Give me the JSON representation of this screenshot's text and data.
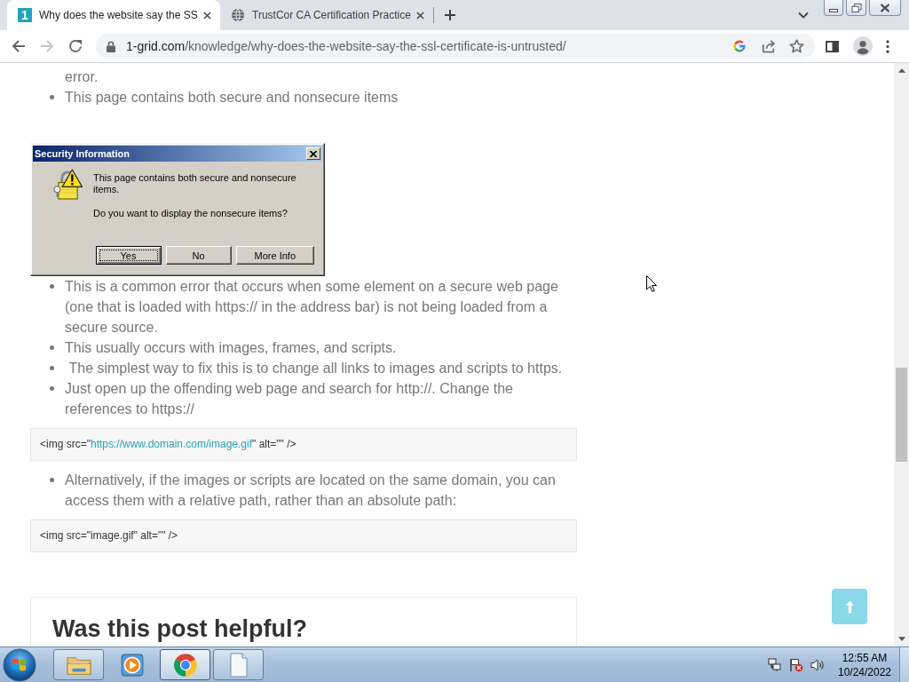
{
  "browser": {
    "tabs": [
      {
        "kind": "logo",
        "favicon_text": "1",
        "title": "Why does the website say the SS",
        "selected": true
      },
      {
        "kind": "globe",
        "title": "TrustCor CA Certification Practice",
        "selected": false
      }
    ],
    "navigation": [
      {
        "kind": "back",
        "disabled": false
      },
      {
        "kind": "forward",
        "disabled": true
      },
      {
        "kind": "reload",
        "disabled": false
      }
    ],
    "address_bar": {
      "host": "1-grid.com",
      "path": "/knowledge/why-does-the-website-say-the-ssl-certificate-is-untrusted/"
    }
  },
  "article": {
    "continued_text": "error.",
    "list_1": [
      "This page contains both secure and nonsecure items"
    ],
    "dialog": {
      "title": "Security Information",
      "message": "This page contains both secure and nonsecure items.",
      "question": "Do you want to display the nonsecure items?",
      "buttons": [
        {
          "label": "Yes",
          "focused": true
        },
        {
          "label": "No",
          "focused": false
        },
        {
          "label": "More Info",
          "focused": false
        }
      ]
    },
    "list_2": [
      "This is a common error that occurs when some element on a secure web page (one that is loaded with https:// in the address bar) is not being loaded from a secure source.",
      "This usually occurs with images, frames, and scripts.",
      " The simplest way to fix this is to change all links to images and scripts to https.",
      "Just open up the offending web page and search for http://. Change the references to https://"
    ],
    "code_1": [
      {
        "kind": "plain",
        "text": "<img src=\""
      },
      {
        "kind": "link",
        "text": "https://www.domain.com/image.gif"
      },
      {
        "kind": "plain",
        "text": "\" alt=\"\" />"
      }
    ],
    "list_3": [
      "Alternatively, if the images or scripts are located on the same domain, you can access them with a relative path, rather than an absolute path:"
    ],
    "code_2": [
      {
        "kind": "plain",
        "text": "<img src=\"image.gif\" alt=\"\" />"
      }
    ],
    "card": {
      "heading": "Was this post helpful?"
    }
  },
  "taskbar": {
    "apps": [
      {
        "kind": "folder",
        "running": true,
        "selected": false
      },
      {
        "kind": "media",
        "running": false,
        "selected": false
      },
      {
        "kind": "chrome",
        "running": true,
        "selected": true
      },
      {
        "kind": "document",
        "running": true,
        "selected": false
      }
    ],
    "clock": {
      "time": "12:55 AM",
      "date": "10/24/2022"
    }
  }
}
